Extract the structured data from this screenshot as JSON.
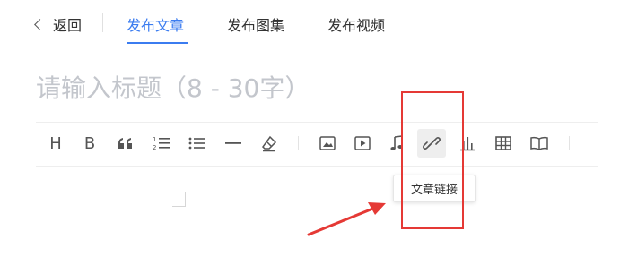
{
  "header": {
    "back_label": "返回",
    "tabs": [
      {
        "label": "发布文章",
        "active": true
      },
      {
        "label": "发布图集",
        "active": false
      },
      {
        "label": "发布视频",
        "active": false
      }
    ]
  },
  "title_input": {
    "value": "",
    "placeholder": "请输入标题（8 - 30字）"
  },
  "toolbar": {
    "heading_label": "H",
    "bold_label": "B",
    "quote_label": "66",
    "buttons": [
      "heading-icon",
      "bold-icon",
      "quote-icon",
      "ordered-list-icon",
      "unordered-list-icon",
      "horizontal-rule-icon",
      "eraser-icon",
      "image-icon",
      "video-icon",
      "music-icon",
      "link-icon",
      "chart-icon",
      "table-icon",
      "book-icon"
    ]
  },
  "tooltip": {
    "text": "文章链接"
  },
  "colors": {
    "accent": "#3b7cf0",
    "annotation": "#e53935"
  }
}
